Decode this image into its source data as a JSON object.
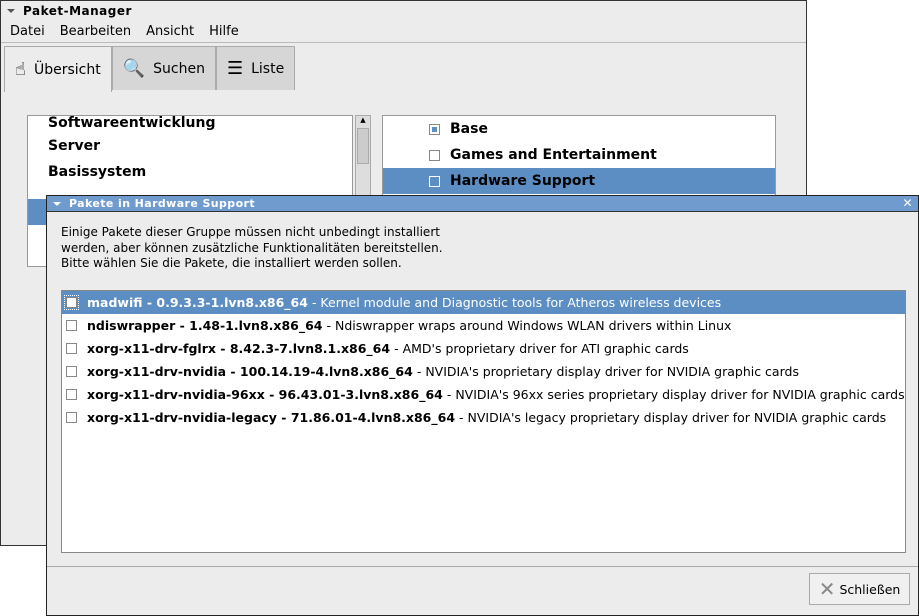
{
  "main_window": {
    "title": "Paket-Manager",
    "menu": [
      "Datei",
      "Bearbeiten",
      "Ansicht",
      "Hilfe"
    ],
    "tabs": [
      {
        "label": "Übersicht",
        "icon": "overview-icon"
      },
      {
        "label": "Suchen",
        "icon": "search-icon"
      },
      {
        "label": "Liste",
        "icon": "list-icon"
      }
    ],
    "categories": [
      "Softwareentwicklung",
      "Server",
      "Basissystem"
    ],
    "groups": [
      {
        "label": "Base",
        "checked": true
      },
      {
        "label": "Games and Entertainment",
        "checked": false
      },
      {
        "label": "Hardware Support",
        "checked": false,
        "selected": true
      }
    ]
  },
  "dialog": {
    "title": "Pakete in Hardware Support",
    "intro": "Einige Pakete dieser Gruppe müssen nicht unbedingt installiert werden, aber können zusätzliche Funktionalitäten bereitstellen. Bitte wählen Sie die Pakete, die installiert werden sollen.",
    "packages": [
      {
        "name": "madwifi - 0.9.3.3-1.lvn8.x86_64",
        "desc": "- Kernel module and Diagnostic tools for Atheros wireless devices"
      },
      {
        "name": "ndiswrapper - 1.48-1.lvn8.x86_64",
        "desc": "- Ndiswrapper wraps around Windows WLAN drivers within Linux"
      },
      {
        "name": "xorg-x11-drv-fglrx - 8.42.3-7.lvn8.1.x86_64",
        "desc": "- AMD's proprietary driver for ATI graphic cards"
      },
      {
        "name": "xorg-x11-drv-nvidia - 100.14.19-4.lvn8.x86_64",
        "desc": "- NVIDIA's proprietary display driver for NVIDIA graphic cards"
      },
      {
        "name": "xorg-x11-drv-nvidia-96xx - 96.43.01-3.lvn8.x86_64",
        "desc": "- NVIDIA's 96xx series proprietary display driver for NVIDIA graphic cards"
      },
      {
        "name": "xorg-x11-drv-nvidia-legacy - 71.86.01-4.lvn8.x86_64",
        "desc": "- NVIDIA's legacy proprietary display driver for NVIDIA graphic cards"
      }
    ],
    "close_label": "Schließen"
  }
}
